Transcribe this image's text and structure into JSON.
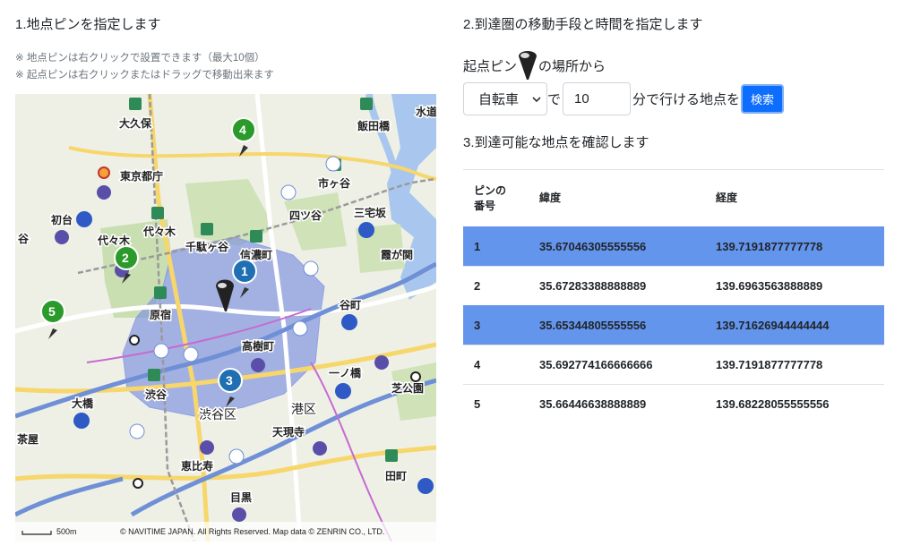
{
  "section1": {
    "title": "1.地点ピンを指定します",
    "notes": [
      "※ 地点ピンは右クリックで設置できます（最大10個）",
      "※ 起点ピンは右クリックまたはドラッグで移動出来ます"
    ]
  },
  "map": {
    "places": [
      "大久保",
      "飯田橋",
      "水道",
      "東京都庁",
      "市ヶ谷",
      "初台",
      "代々木",
      "四ツ谷",
      "三宅坂",
      "千駄ヶ谷",
      "信濃町",
      "霞が関",
      "代々木",
      "原宿",
      "谷町",
      "高樹町",
      "一ノ橋",
      "渋谷",
      "渋谷区",
      "港区",
      "芝公園",
      "大橋",
      "天現寺",
      "恵比寿",
      "目黒",
      "田町",
      "茶屋",
      "谷"
    ],
    "pins": [
      "1",
      "2",
      "3",
      "4",
      "5"
    ],
    "scale": "500m",
    "copyright": "© NAVITIME JAPAN. All Rights Reserved. Map data © ZENRIN CO., LTD.",
    "colors": {
      "isochrone": "#7b8fe0",
      "pin_blue": "#1f6fb2",
      "pin_green": "#2a9a2a"
    }
  },
  "section2": {
    "title": "2.到達圏の移動手段と時間を指定します",
    "origin_prefix": "起点ピン",
    "origin_suffix": "の場所から",
    "mode_value": "自転車",
    "particle_de": "で",
    "minutes_value": "10",
    "suffix_text": "分で行ける地点を",
    "search_label": "検索"
  },
  "section3": {
    "title": "3.到達可能な地点を確認します",
    "headers": [
      "ピンの\n番号",
      "緯度",
      "経度"
    ],
    "rows": [
      {
        "no": "1",
        "lat": "35.67046305555556",
        "lng": "139.7191877777778",
        "highlight": true
      },
      {
        "no": "2",
        "lat": "35.67283388888889",
        "lng": "139.6963563888889",
        "highlight": false
      },
      {
        "no": "3",
        "lat": "35.65344805555556",
        "lng": "139.71626944444444",
        "highlight": true
      },
      {
        "no": "4",
        "lat": "35.692774166666666",
        "lng": "139.7191877777778",
        "highlight": false
      },
      {
        "no": "5",
        "lat": "35.66446638888889",
        "lng": "139.68228055555556",
        "highlight": false
      }
    ]
  },
  "colors": {
    "accent": "#0d6efd",
    "row_highlight": "#6495ed"
  }
}
